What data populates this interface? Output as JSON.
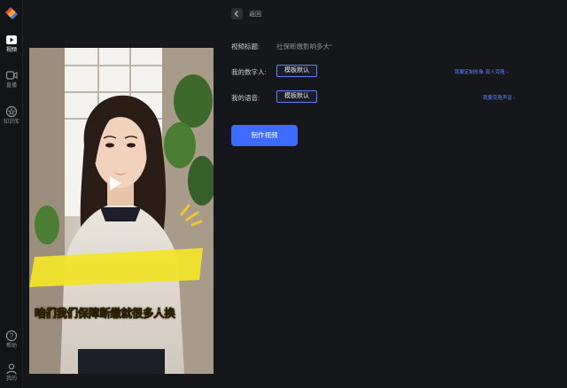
{
  "sidebar": {
    "items": [
      {
        "label": "视频",
        "icon": "video-icon"
      },
      {
        "label": "直播",
        "icon": "live-icon"
      },
      {
        "label": "知识库",
        "icon": "knowledge-icon"
      }
    ],
    "bottom": [
      {
        "label": "帮助",
        "icon": "help-icon"
      },
      {
        "label": "我的",
        "icon": "user-icon"
      }
    ]
  },
  "topbar": {
    "back_label": "返回"
  },
  "form": {
    "title_label": "视频标题:",
    "title_value": "社保断缴影响多大\"",
    "avatar_label": "我的数字人:",
    "avatar_button": "模板默认",
    "avatar_link": "我要定制形象·真人克隆 ›",
    "voice_label": "我的语音:",
    "voice_button": "模板默认",
    "voice_link": "我要克隆声音 ›",
    "make_button": "制作视频"
  },
  "video": {
    "caption": "咱们我们保障断缴就很多人换"
  },
  "colors": {
    "background": "#16171b",
    "accent": "#3e6bff",
    "caption": "#ffe23a"
  }
}
